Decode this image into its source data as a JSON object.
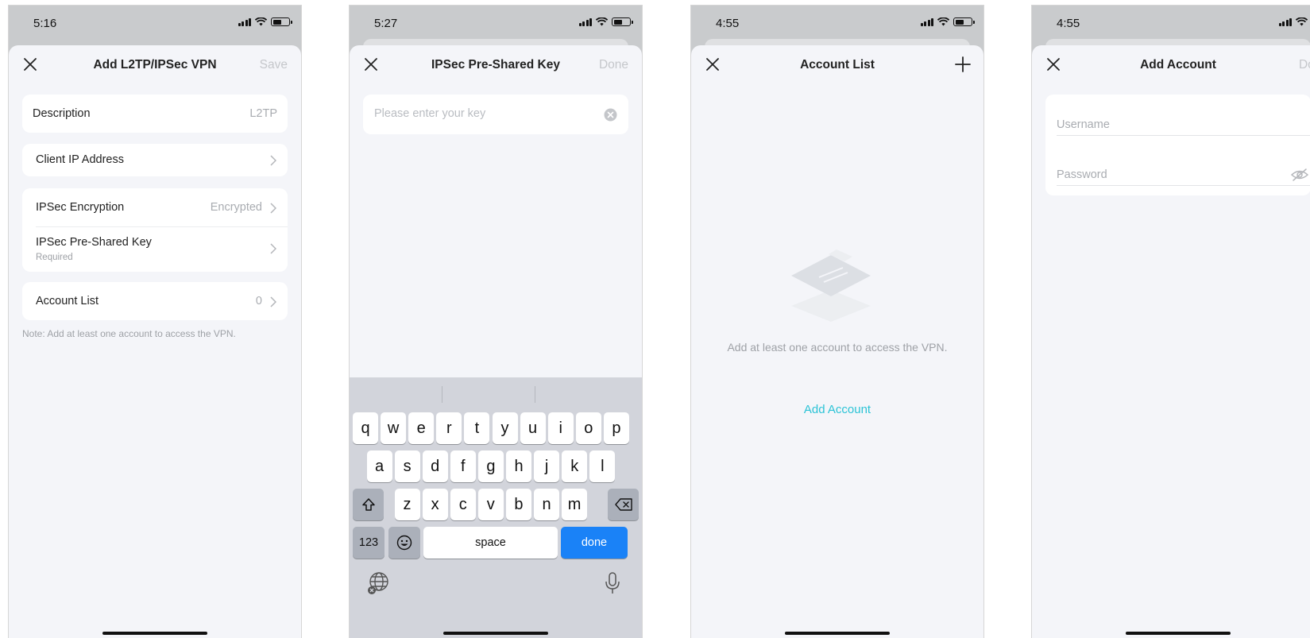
{
  "screens": [
    {
      "time": "5:16",
      "nav": {
        "title": "Add L2TP/IPSec VPN",
        "action": "Save"
      },
      "description": {
        "label": "Description",
        "value": "L2TP"
      },
      "client_ip": {
        "label": "Client IP Address"
      },
      "ipsec_encryption": {
        "label": "IPSec Encryption",
        "value": "Encrypted"
      },
      "ipsec_psk": {
        "label": "IPSec Pre-Shared Key",
        "sub": "Required"
      },
      "account_list": {
        "label": "Account List",
        "value": "0"
      },
      "note": "Note: Add at least one account to access the VPN."
    },
    {
      "time": "5:27",
      "nav": {
        "title": "IPSec Pre-Shared Key",
        "action": "Done"
      },
      "key_input": {
        "placeholder": "Please enter your key"
      },
      "keyboard": {
        "row1": [
          "q",
          "w",
          "e",
          "r",
          "t",
          "y",
          "u",
          "i",
          "o",
          "p"
        ],
        "row2": [
          "a",
          "s",
          "d",
          "f",
          "g",
          "h",
          "j",
          "k",
          "l"
        ],
        "row3": [
          "z",
          "x",
          "c",
          "v",
          "b",
          "n",
          "m"
        ],
        "numbers_key": "123",
        "space_key": "space",
        "done_key": "done"
      }
    },
    {
      "time": "4:55",
      "nav": {
        "title": "Account List"
      },
      "empty_text": "Add at least one account to access the VPN.",
      "add_account": "Add Account"
    },
    {
      "time": "4:55",
      "nav": {
        "title": "Add Account",
        "action": "Done"
      },
      "username_placeholder": "Username",
      "password_placeholder": "Password"
    }
  ],
  "colors": {
    "accent_teal": "#2bc3d6",
    "keyboard_done_blue": "#1a82f7",
    "disabled_text": "#c5c7cb",
    "sheet_background": "#f4f5f9"
  },
  "icons": [
    "close-icon",
    "chevron-right-icon",
    "clear-icon",
    "globe-icon",
    "microphone-icon",
    "shift-icon",
    "backspace-icon",
    "emoji-icon",
    "plus-icon",
    "empty-list-icon",
    "eye-off-icon",
    "wifi-icon",
    "battery-icon",
    "signal-icon"
  ]
}
